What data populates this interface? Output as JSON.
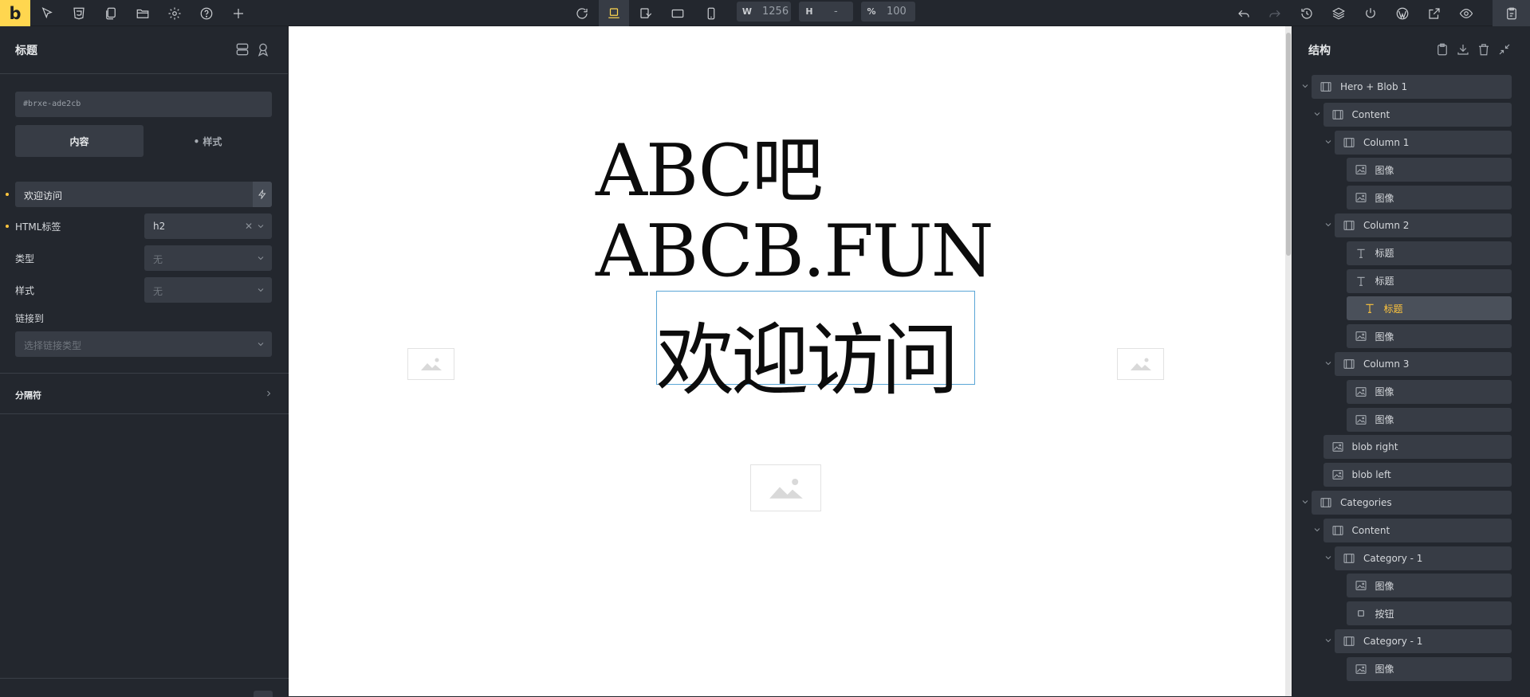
{
  "topbar": {
    "logo": "b",
    "left_icons": [
      "select-arrow-icon",
      "css3-icon",
      "pages-icon",
      "folder-icon",
      "settings-icon",
      "help-icon",
      "add-icon"
    ],
    "center_icons": [
      "refresh-icon",
      "desktop-icon",
      "laptop-icon",
      "tablet-landscape-icon",
      "mobile-icon"
    ],
    "width_label": "W",
    "width_value": "1256",
    "height_label": "H",
    "height_value": "-",
    "zoom_label": "%",
    "zoom_value": "100",
    "right_icons": [
      "undo-icon",
      "redo-icon",
      "history-icon",
      "layers-icon",
      "power-icon",
      "wordpress-icon",
      "external-link-icon",
      "preview-eye-icon",
      "save-icon"
    ]
  },
  "left_panel": {
    "title": "标题",
    "element_id": "#brxe-ade2cb",
    "tabs": [
      {
        "label": "内容",
        "active": true
      },
      {
        "label": "• 样式",
        "active": false
      }
    ],
    "text_value": "欢迎访问",
    "controls": [
      {
        "label": "HTML标签",
        "value": "h2",
        "has_dot": true,
        "dim": false
      },
      {
        "label": "类型",
        "value": "无",
        "has_dot": false,
        "dim": true
      },
      {
        "label": "样式",
        "value": "无",
        "has_dot": false,
        "dim": true
      }
    ],
    "link_label": "链接到",
    "link_placeholder": "选择链接类型",
    "section_title": "分隔符"
  },
  "canvas": {
    "heading_1": "ABC吧",
    "heading_2": "ABCB.FUN",
    "heading_3": "欢迎访问"
  },
  "right_panel": {
    "title": "结构",
    "header_icons": [
      "clipboard-icon",
      "download-icon",
      "trash-icon",
      "collapse-icon"
    ],
    "tree": [
      {
        "label": "Hero + Blob 1",
        "type": "section",
        "depth": 0,
        "caret": true
      },
      {
        "label": "Content",
        "type": "container",
        "depth": 1,
        "caret": true
      },
      {
        "label": "Column 1",
        "type": "block",
        "depth": 2,
        "caret": true
      },
      {
        "label": "图像",
        "type": "image",
        "depth": 3,
        "caret": false
      },
      {
        "label": "图像",
        "type": "image",
        "depth": 3,
        "caret": false
      },
      {
        "label": "Column 2",
        "type": "block",
        "depth": 2,
        "caret": true
      },
      {
        "label": "标题",
        "type": "heading",
        "depth": 3,
        "caret": false
      },
      {
        "label": "标题",
        "type": "heading",
        "depth": 3,
        "caret": false
      },
      {
        "label": "标题",
        "type": "heading",
        "depth": 3,
        "caret": false,
        "selected": true
      },
      {
        "label": "图像",
        "type": "image",
        "depth": 3,
        "caret": false
      },
      {
        "label": "Column 3",
        "type": "block",
        "depth": 2,
        "caret": true
      },
      {
        "label": "图像",
        "type": "image",
        "depth": 3,
        "caret": false
      },
      {
        "label": "图像",
        "type": "image",
        "depth": 3,
        "caret": false
      },
      {
        "label": "blob  right",
        "type": "image",
        "depth": 1,
        "caret": false
      },
      {
        "label": "blob left",
        "type": "image",
        "depth": 1,
        "caret": false
      },
      {
        "label": "Categories",
        "type": "section",
        "depth": 0,
        "caret": true
      },
      {
        "label": "Content",
        "type": "container",
        "depth": 1,
        "caret": true
      },
      {
        "label": "Category - 1",
        "type": "block",
        "depth": 2,
        "caret": true
      },
      {
        "label": "图像",
        "type": "image",
        "depth": 3,
        "caret": false
      },
      {
        "label": "按钮",
        "type": "button",
        "depth": 3,
        "caret": false
      },
      {
        "label": "Category - 1",
        "type": "block",
        "depth": 2,
        "caret": true
      },
      {
        "label": "图像",
        "type": "image",
        "depth": 3,
        "caret": false
      }
    ]
  },
  "colors": {
    "accent": "#ffd64f",
    "selected_text": "#ffc53d",
    "panel_bg": "#23272e",
    "field_bg": "#373c45",
    "selection_border": "#5aa6d6"
  }
}
